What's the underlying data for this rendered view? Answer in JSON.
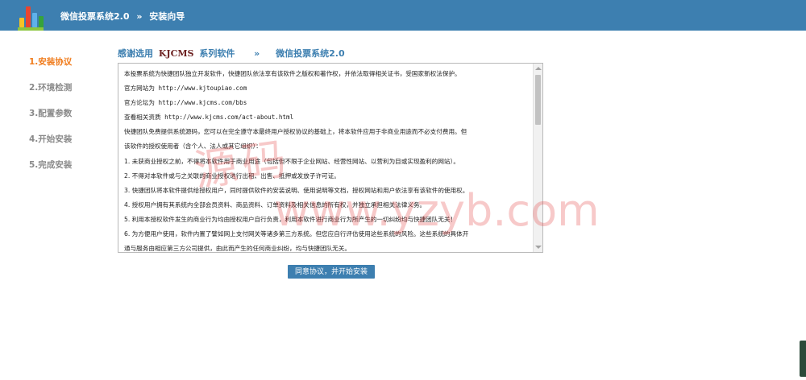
{
  "header": {
    "app_title": "微信投票系统2.0",
    "separator": "»",
    "page_name": "安装向导"
  },
  "steps": [
    {
      "label": "1.安装协议",
      "active": true
    },
    {
      "label": "2.环境检测",
      "active": false
    },
    {
      "label": "3.配置参数",
      "active": false
    },
    {
      "label": "4.开始安装",
      "active": false
    },
    {
      "label": "5.完成安装",
      "active": false
    }
  ],
  "title": {
    "prefix": "感谢选用",
    "brand": "KJCMS",
    "suffix": "系列软件",
    "arrow": "»",
    "product": "微信投票系统2.0"
  },
  "license": {
    "lines": [
      "本投票系统为快捷团队独立开发软件，快捷团队依法享有该软件之版权和著作权，并依法取得相关证书，受国家新权法保护。",
      "官方网站为 http://www.kjtoupiao.com",
      "官方论坛为 http://www.kjcms.com/bbs",
      "查看相关资质 http://www.kjcms.com/act-about.html",
      "快捷团队免费提供系统源码，您可以在完全遵守本最终用户授权协议的基础上，将本软件应用于非商业用途而不必支付费用。但",
      "该软件的授权使用者（含个人、法人或其它组织）：",
      "1.  未获商业授权之前，不得将本软件用于商业用途（包括但不限于企业网站、经营性网站、以营利为目或实现盈利的网站）。",
      "2.  不得对本软件或与之关联的商业授权进行出租、出售、抵押或发放子许可证。",
      "3.  快捷团队将本软件提供给授权用户，同时提供软件的安装说明、使用说明等文档，授权网站和用户依法享有该软件的使用权。",
      "4.  授权用户拥有其系统内全部会员资料、商品资料、订单资料及相关信息的所有权，并独立承担相关法律义务。",
      "5.  利用本授权软件发生的商业行为均由授权用户自行负责，利用本软件进行商业行为所产生的一切纠纷均与快捷团队无关！",
      "6.  为方便用户使用，软件内置了譬如网上支付网关等诸多第三方系统。但您应自行评估使用这些系统的风险。这些系统的具体开",
      "通与服务由相应第三方公司提供，由此而产生的任何商业纠纷，均与快捷团队无关。"
    ]
  },
  "watermark": {
    "cn": "源码",
    "url": "www.yzyb.com"
  },
  "agree_button": "同意协议，并开始安装",
  "colors": {
    "header_bg": "#3d7fb0",
    "active_step": "#f07c1d",
    "inactive_step": "#8a8a8a",
    "title_blue": "#3d7fb0",
    "brand_red": "#6d2222"
  }
}
